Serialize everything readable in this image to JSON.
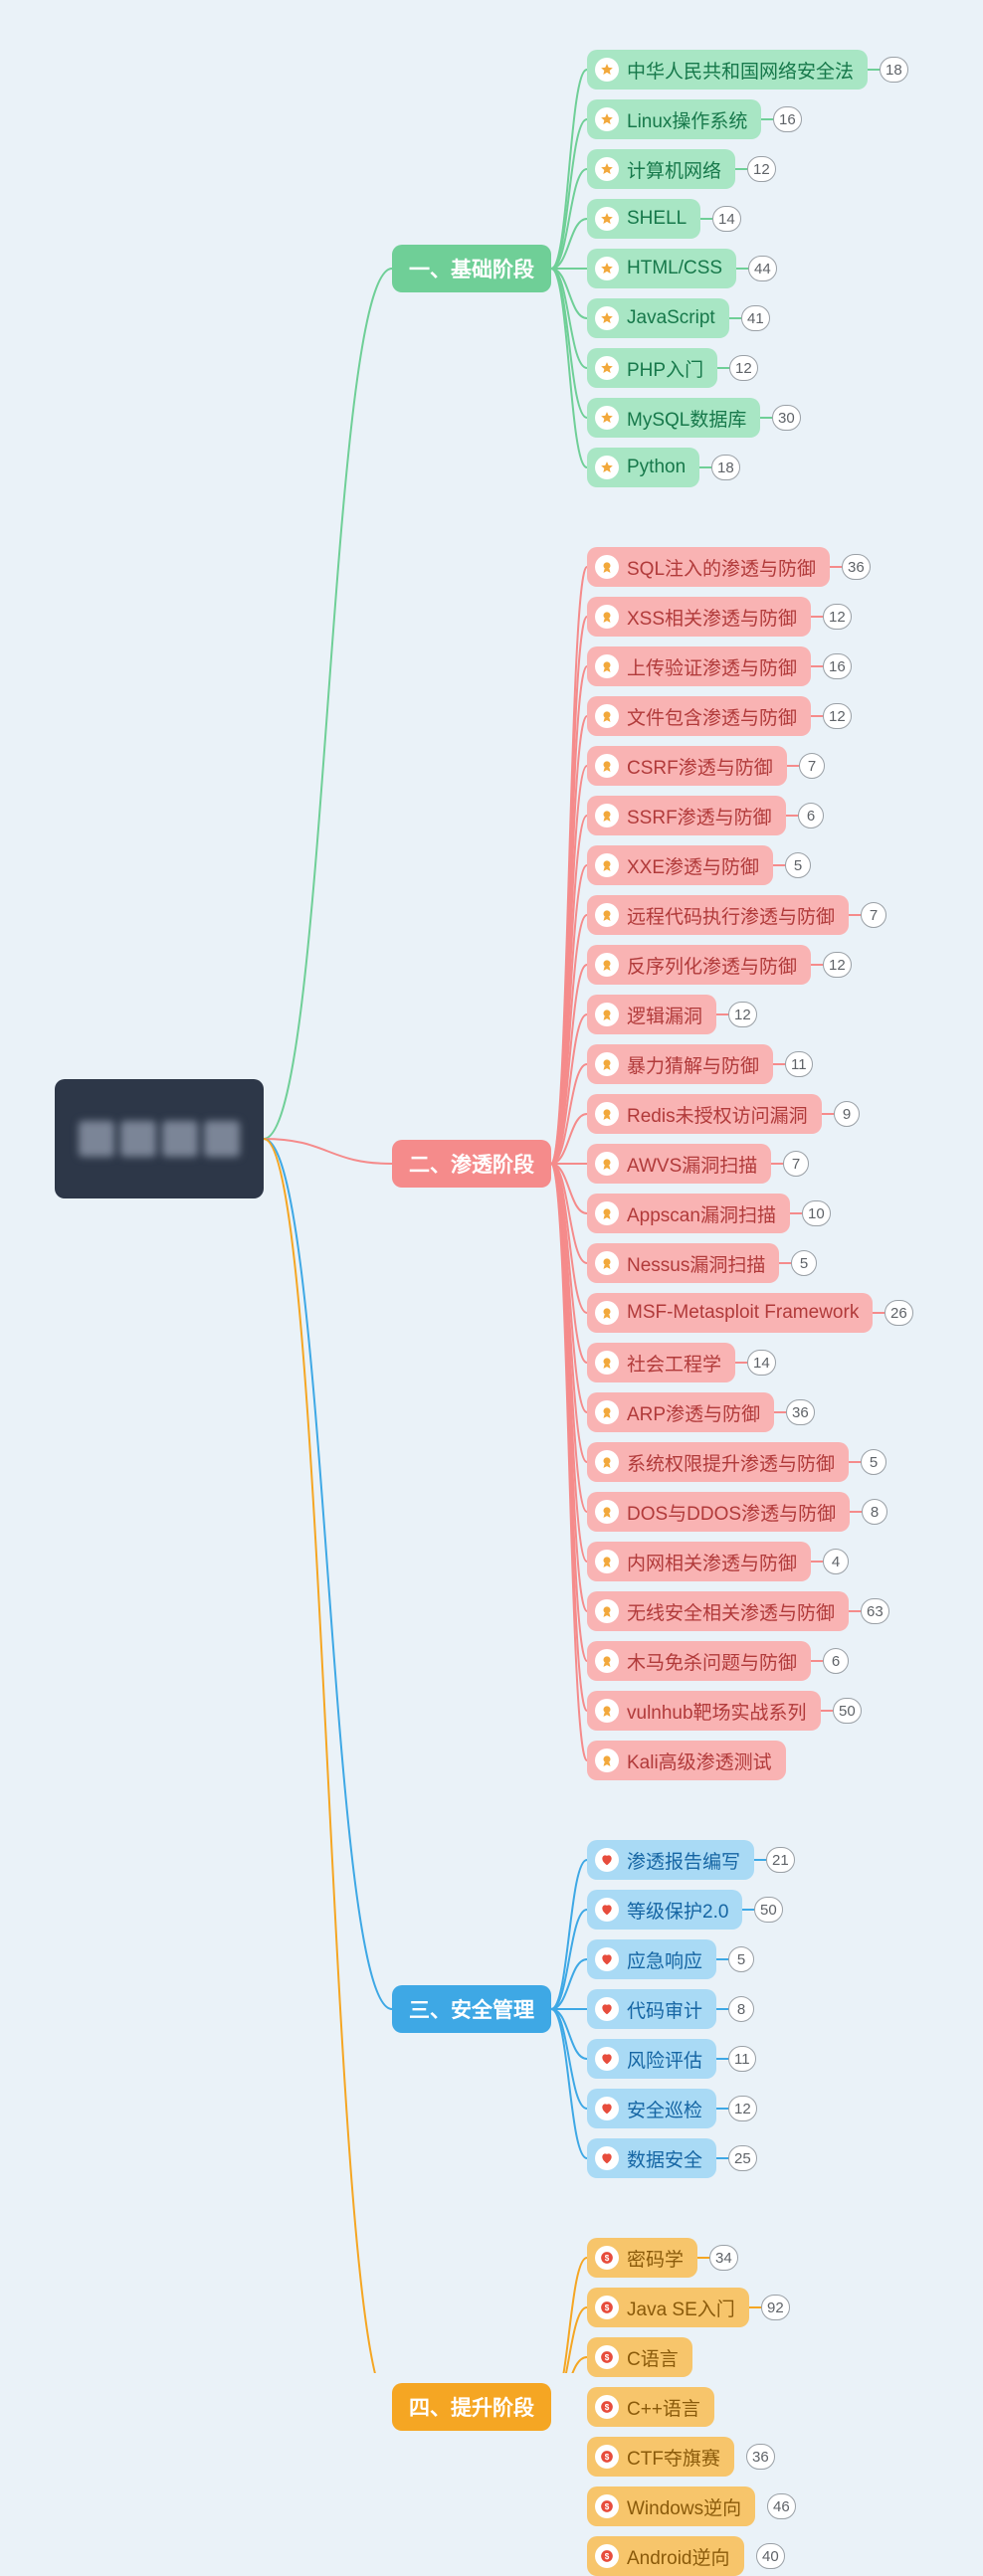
{
  "root": {
    "obscured": true
  },
  "layout": {
    "rootY": 1145,
    "catX": 394,
    "leafX": 590,
    "leafH": 40,
    "leafGap": 10
  },
  "categories": [
    {
      "id": "basics",
      "label": "一、基础阶段",
      "catClass": "green-cat",
      "leafClass": "green-leaf",
      "leafIcon": "star",
      "items": [
        {
          "label": "中华人民共和国网络安全法",
          "count": 18
        },
        {
          "label": "Linux操作系统",
          "count": 16
        },
        {
          "label": "计算机网络",
          "count": 12
        },
        {
          "label": "SHELL",
          "count": 14
        },
        {
          "label": "HTML/CSS",
          "count": 44
        },
        {
          "label": "JavaScript",
          "count": 41
        },
        {
          "label": "PHP入门",
          "count": 12
        },
        {
          "label": "MySQL数据库",
          "count": 30
        },
        {
          "label": "Python",
          "count": 18
        }
      ]
    },
    {
      "id": "pentest",
      "label": "二、渗透阶段",
      "catClass": "pink-cat",
      "leafClass": "pink-leaf",
      "leafIcon": "medal",
      "items": [
        {
          "label": "SQL注入的渗透与防御",
          "count": 36
        },
        {
          "label": "XSS相关渗透与防御",
          "count": 12
        },
        {
          "label": "上传验证渗透与防御",
          "count": 16
        },
        {
          "label": "文件包含渗透与防御",
          "count": 12
        },
        {
          "label": "CSRF渗透与防御",
          "count": 7
        },
        {
          "label": "SSRF渗透与防御",
          "count": 6
        },
        {
          "label": "XXE渗透与防御",
          "count": 5
        },
        {
          "label": "远程代码执行渗透与防御",
          "count": 7
        },
        {
          "label": "反序列化渗透与防御",
          "count": 12
        },
        {
          "label": "逻辑漏洞",
          "count": 12
        },
        {
          "label": "暴力猜解与防御",
          "count": 11
        },
        {
          "label": "Redis未授权访问漏洞",
          "count": 9
        },
        {
          "label": "AWVS漏洞扫描",
          "count": 7
        },
        {
          "label": "Appscan漏洞扫描",
          "count": 10
        },
        {
          "label": "Nessus漏洞扫描",
          "count": 5
        },
        {
          "label": "MSF-Metasploit Framework",
          "count": 26
        },
        {
          "label": "社会工程学",
          "count": 14
        },
        {
          "label": "ARP渗透与防御",
          "count": 36
        },
        {
          "label": "系统权限提升渗透与防御",
          "count": 5
        },
        {
          "label": "DOS与DDOS渗透与防御",
          "count": 8
        },
        {
          "label": "内网相关渗透与防御",
          "count": 4
        },
        {
          "label": "无线安全相关渗透与防御",
          "count": 63
        },
        {
          "label": "木马免杀问题与防御",
          "count": 6
        },
        {
          "label": "vulnhub靶场实战系列",
          "count": 50
        },
        {
          "label": "Kali高级渗透测试",
          "count": null
        }
      ]
    },
    {
      "id": "mgmt",
      "label": "三、安全管理",
      "catClass": "blue-cat",
      "leafClass": "blue-leaf",
      "leafIcon": "heart",
      "items": [
        {
          "label": "渗透报告编写",
          "count": 21
        },
        {
          "label": "等级保护2.0",
          "count": 50
        },
        {
          "label": "应急响应",
          "count": 5
        },
        {
          "label": "代码审计",
          "count": 8
        },
        {
          "label": "风险评估",
          "count": 11
        },
        {
          "label": "安全巡检",
          "count": 12
        },
        {
          "label": "数据安全",
          "count": 25
        }
      ]
    },
    {
      "id": "advance",
      "label": "四、提升阶段",
      "catClass": "orange-cat",
      "leafClass": "orange-leaf",
      "leafIcon": "dollar",
      "items": [
        {
          "label": "密码学",
          "count": 34
        },
        {
          "label": "Java SE入门",
          "count": 92
        },
        {
          "label": "C语言",
          "count": null
        },
        {
          "label": "C++语言",
          "count": null
        },
        {
          "label": "CTF夺旗赛",
          "count": 36
        },
        {
          "label": "Windows逆向",
          "count": 46
        },
        {
          "label": "Android逆向",
          "count": 40
        }
      ]
    }
  ]
}
